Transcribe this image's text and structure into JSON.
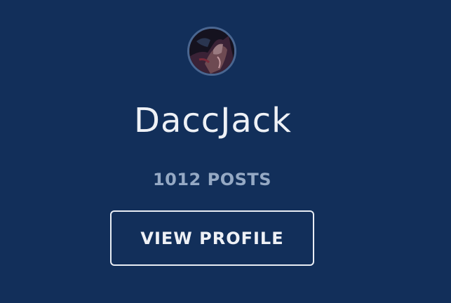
{
  "profile": {
    "username": "DaccJack",
    "post_count": "1012",
    "post_label": "POSTS",
    "avatar_icon": "user-avatar-image"
  },
  "actions": {
    "view_profile_label": "VIEW PROFILE"
  },
  "colors": {
    "background": "#122f5a",
    "username_text": "#eef1f6",
    "posts_text": "#95a9c4",
    "button_border": "#e8edf4",
    "avatar_ring": "#4a6690"
  }
}
